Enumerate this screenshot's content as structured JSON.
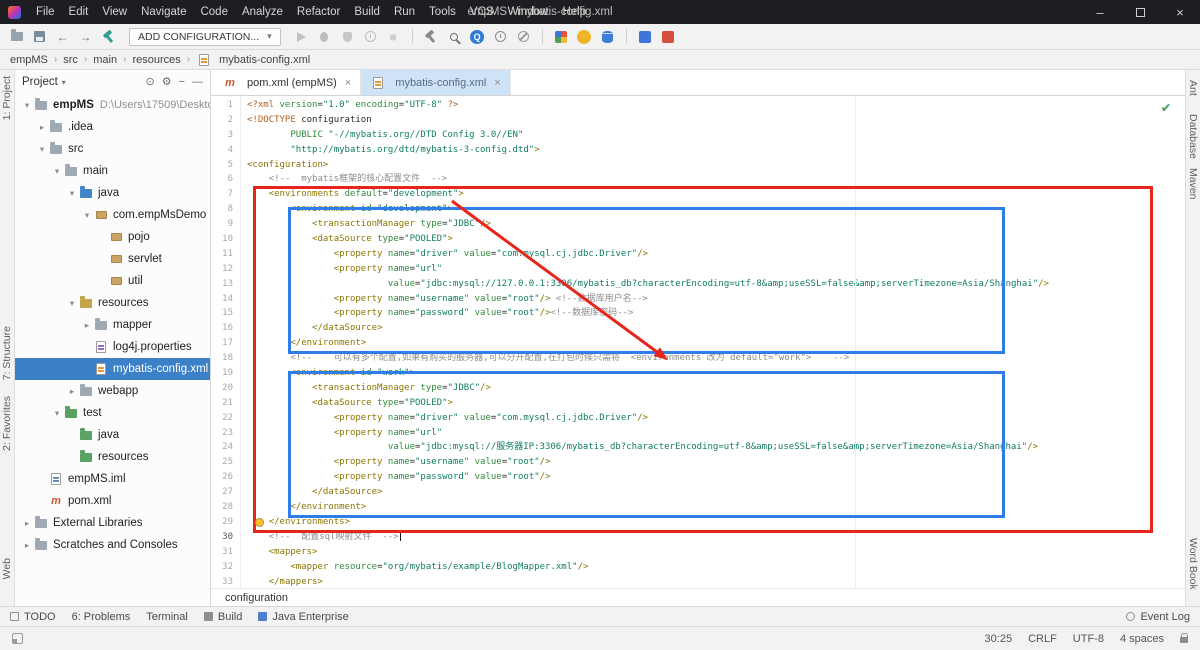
{
  "titlebar": {
    "title": "empMS - mybatis-config.xml",
    "menus": [
      "File",
      "Edit",
      "View",
      "Navigate",
      "Code",
      "Analyze",
      "Refactor",
      "Build",
      "Run",
      "Tools",
      "VCS",
      "Window",
      "Help"
    ]
  },
  "toolbar": {
    "items": [
      {
        "type": "icon",
        "name": "open-icon",
        "draw": "folder"
      },
      {
        "type": "icon",
        "name": "save-icon",
        "draw": "save"
      },
      {
        "type": "icon",
        "name": "undo-icon",
        "draw": "glyph",
        "glyph": "←",
        "color": "#6e6e6e"
      },
      {
        "type": "icon",
        "name": "redo-icon",
        "draw": "glyph",
        "glyph": "→",
        "color": "#6e6e6e"
      },
      {
        "type": "icon",
        "name": "build-icon",
        "draw": "hammer",
        "color": "#2f9e9b"
      },
      {
        "type": "button",
        "name": "add-configuration-button",
        "label": "ADD CONFIGURATION...",
        "caret": "▾"
      },
      {
        "type": "icon",
        "name": "run-icon",
        "draw": "play",
        "color": "#c2c2c2"
      },
      {
        "type": "icon",
        "name": "debug-icon",
        "draw": "bug",
        "color": "#bdbdbd"
      },
      {
        "type": "icon",
        "name": "coverage-icon",
        "draw": "shield",
        "color": "#c6c6c6"
      },
      {
        "type": "icon",
        "name": "profiler-icon",
        "draw": "clock",
        "color": "#bdbdbd"
      },
      {
        "type": "icon",
        "name": "stop-icon",
        "draw": "glyph",
        "glyph": "■",
        "color": "#cfcfcf"
      },
      {
        "type": "sep"
      },
      {
        "type": "icon",
        "name": "hammer-icon",
        "draw": "hammer",
        "color": "#8a8a8a"
      },
      {
        "type": "icon",
        "name": "search-icon",
        "draw": "magnifier",
        "color": "#6f6f6f"
      },
      {
        "type": "icon",
        "name": "search-everywhere-icon",
        "draw": "ball",
        "glyph": "Q",
        "color": "#2f7bd3"
      },
      {
        "type": "icon",
        "name": "clock-icon",
        "draw": "clock",
        "color": "#8a8a8a"
      },
      {
        "type": "icon",
        "name": "power-save-icon",
        "draw": "nosign",
        "color": "#9a9a9a"
      },
      {
        "type": "sep"
      },
      {
        "type": "icon",
        "name": "plugin-grid-icon",
        "draw": "grid"
      },
      {
        "type": "icon",
        "name": "plugin-ball-icon",
        "draw": "ball",
        "glyph": "",
        "color": "#f0b429"
      },
      {
        "type": "icon",
        "name": "database-icon",
        "draw": "db",
        "color": "#3d7fd6"
      },
      {
        "type": "sep"
      },
      {
        "type": "icon",
        "name": "plugin-blue-icon",
        "draw": "sq",
        "color": "#3f74d8"
      },
      {
        "type": "icon",
        "name": "plugin-red-icon",
        "draw": "sq",
        "color": "#d64f3f"
      }
    ]
  },
  "breadcrumbs": [
    "empMS",
    "src",
    "main",
    "resources",
    "mybatis-config.xml"
  ],
  "left_stripe": [
    "1: Project",
    "7: Structure",
    "2: Favorites",
    "Web"
  ],
  "right_stripe": [
    "Ant",
    "Database",
    "Maven",
    "Word Book"
  ],
  "project_panel": {
    "title": "Project",
    "header_icons": [
      {
        "name": "locate-icon",
        "glyph": "⊙"
      },
      {
        "name": "settings-icon",
        "glyph": "⚙"
      },
      {
        "name": "collapse-all-icon",
        "glyph": "−"
      },
      {
        "name": "hide-icon",
        "glyph": "—"
      }
    ],
    "tree": [
      {
        "label": "empMS",
        "suffix": "D:\\Users\\17509\\Deskto",
        "level": 0,
        "chev": "open",
        "icon": "folder",
        "bold": true
      },
      {
        "label": ".idea",
        "level": 1,
        "chev": "closed",
        "icon": "folder"
      },
      {
        "label": "src",
        "level": 1,
        "chev": "open",
        "icon": "folder"
      },
      {
        "label": "main",
        "level": 2,
        "chev": "open",
        "icon": "folder"
      },
      {
        "label": "java",
        "level": 3,
        "chev": "open",
        "icon": "src"
      },
      {
        "label": "com.empMsDemo",
        "level": 4,
        "chev": "open",
        "icon": "pkg"
      },
      {
        "label": "pojo",
        "level": 5,
        "icon": "pkg"
      },
      {
        "label": "servlet",
        "level": 5,
        "icon": "pkg"
      },
      {
        "label": "util",
        "level": 5,
        "icon": "pkg"
      },
      {
        "label": "resources",
        "level": 3,
        "chev": "open",
        "icon": "res"
      },
      {
        "label": "mapper",
        "level": 4,
        "chev": "closed",
        "icon": "folder"
      },
      {
        "label": "log4j.properties",
        "level": 4,
        "icon": "fprop"
      },
      {
        "label": "mybatis-config.xml",
        "level": 4,
        "icon": "fxml",
        "selected": true
      },
      {
        "label": "webapp",
        "level": 3,
        "chev": "closed",
        "icon": "folder"
      },
      {
        "label": "test",
        "level": 2,
        "chev": "open",
        "icon": "test"
      },
      {
        "label": "java",
        "level": 3,
        "icon": "test"
      },
      {
        "label": "resources",
        "level": 3,
        "icon": "test"
      },
      {
        "label": "empMS.iml",
        "level": 1,
        "icon": "fiml"
      },
      {
        "label": "pom.xml",
        "level": 1,
        "icon": "maven"
      },
      {
        "label": "External Libraries",
        "level": 0,
        "chev": "closed",
        "icon": "lib"
      },
      {
        "label": "Scratches and Consoles",
        "level": 0,
        "chev": "closed",
        "icon": "scratch"
      }
    ]
  },
  "tabs": [
    {
      "label": "pom.xml (empMS)",
      "icon": "maven"
    },
    {
      "label": "mybatis-config.xml",
      "icon": "xml",
      "active": true
    }
  ],
  "editor": {
    "current_line": 30,
    "inspection_glyph": "✔",
    "lines": [
      "<?xml version=\"1.0\" encoding=\"UTF-8\" ?>",
      "<!DOCTYPE configuration",
      "        PUBLIC \"-//mybatis.org//DTD Config 3.0//EN\"",
      "        \"http://mybatis.org/dtd/mybatis-3-config.dtd\">",
      "<configuration>",
      "    <!--  mybatis框架的核心配置文件  -->",
      "    <environments default=\"development\">",
      "        <environment id=\"development\">",
      "            <transactionManager type=\"JDBC\"/>",
      "            <dataSource type=\"POOLED\">",
      "                <property name=\"driver\" value=\"com.mysql.cj.jdbc.Driver\"/>",
      "                <property name=\"url\"",
      "                          value=\"jdbc:mysql://127.0.0.1:3306/mybatis_db?characterEncoding=utf-8&amp;useSSL=false&amp;serverTimezone=Asia/Shanghai\"/>",
      "                <property name=\"username\" value=\"root\"/> <!--数据库用户名-->",
      "                <property name=\"password\" value=\"root\"/><!--数据库密码-->",
      "            </dataSource>",
      "        </environment>",
      "        <!--    可以有多个配置,如果有购买的服务器,可以分开配置,在打包时候只需将  <environments 改为 default=\"work\">    -->",
      "        <environment id=\"work\">",
      "            <transactionManager type=\"JDBC\"/>",
      "            <dataSource type=\"POOLED\">",
      "                <property name=\"driver\" value=\"com.mysql.cj.jdbc.Driver\"/>",
      "                <property name=\"url\"",
      "                          value=\"jdbc:mysql://服务器IP:3306/mybatis_db?characterEncoding=utf-8&amp;useSSL=false&amp;serverTimezone=Asia/Shanghai\"/>",
      "                <property name=\"username\" value=\"root\"/>",
      "                <property name=\"password\" value=\"root\"/>",
      "            </dataSource>",
      "        </environment>",
      "    </environments>",
      "    <!--  配置sql映射文件  -->",
      "    <mappers>",
      "        <mapper resource=\"org/mybatis/example/BlogMapper.xml\"/>",
      "    </mappers>"
    ]
  },
  "bottom_breadcrumb": "configuration",
  "toolwindow_bar": {
    "left": [
      {
        "name": "todo-button",
        "label": "TODO",
        "icon": "todo"
      },
      {
        "name": "problems-button",
        "label": "6: Problems"
      },
      {
        "name": "terminal-button",
        "label": "Terminal"
      },
      {
        "name": "build-button",
        "label": "Build",
        "icon": "hammer"
      },
      {
        "name": "java-enterprise-button",
        "label": "Java Enterprise",
        "icon": "javaee"
      }
    ],
    "right": {
      "name": "event-log-button",
      "label": "Event Log",
      "icon": "event"
    }
  },
  "statusbar": {
    "items": [
      {
        "name": "caret-position",
        "label": "30:25"
      },
      {
        "name": "line-ending",
        "label": "CRLF"
      },
      {
        "name": "encoding",
        "label": "UTF-8"
      },
      {
        "name": "indent-style",
        "label": "4 spaces"
      }
    ]
  },
  "colors": {
    "accent_red": "#e8251d",
    "accent_blue": "#2e7de9",
    "selection_blue": "#3c80c8"
  }
}
